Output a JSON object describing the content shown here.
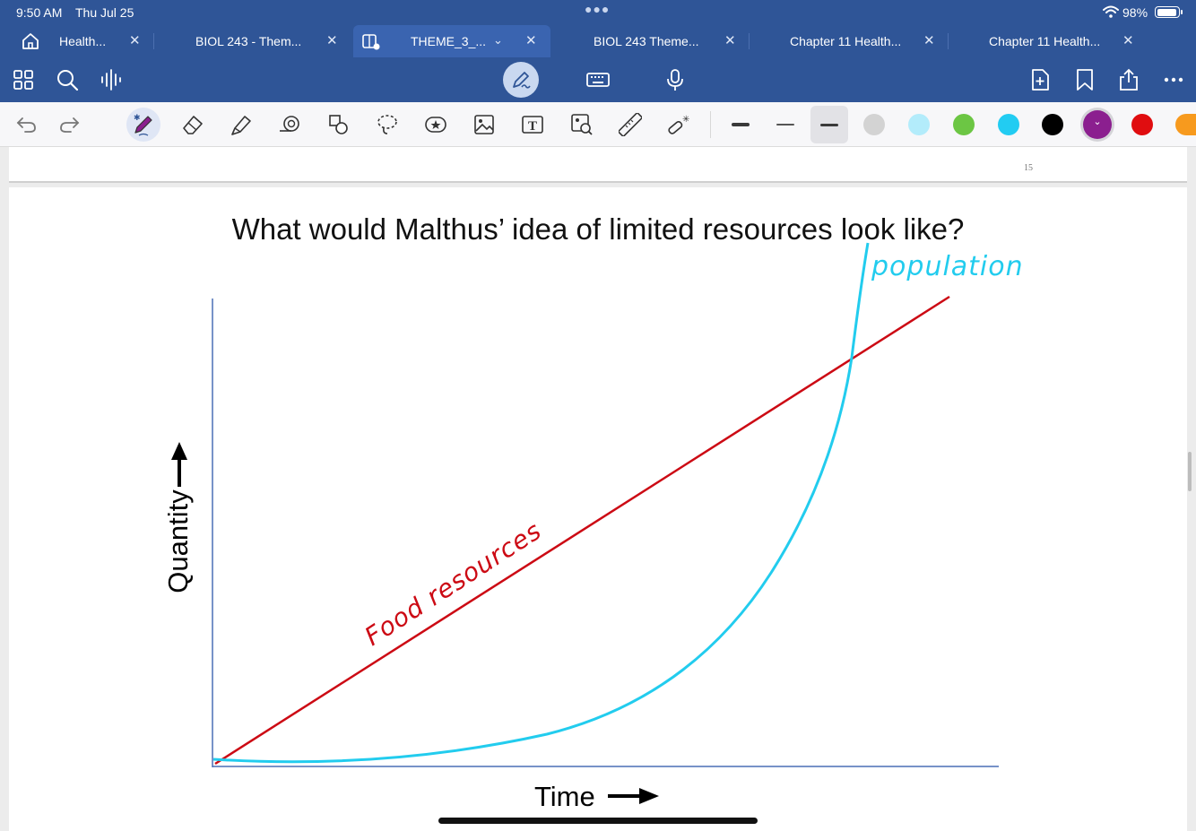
{
  "status_bar": {
    "time": "9:50 AM",
    "date": "Thu Jul 25",
    "battery_percent": "98%",
    "battery_level": 0.98
  },
  "tabs": [
    {
      "label": "Health...",
      "has_close": true,
      "active": false
    },
    {
      "label": "BIOL 243 - Them...",
      "has_close": true,
      "active": false
    },
    {
      "label": "THEME_3_...",
      "has_close": true,
      "active": true
    },
    {
      "label": "BIOL 243 Theme...",
      "has_close": true,
      "active": false
    },
    {
      "label": "Chapter 11 Health...",
      "has_close": true,
      "active": false
    },
    {
      "label": "Chapter 11 Health...",
      "has_close": true,
      "active": false
    }
  ],
  "toolbar": {
    "left_icons": [
      "grid-icon",
      "search-icon",
      "audio-waveform-icon"
    ],
    "center_icons": [
      "pen-mode-icon",
      "keyboard-icon",
      "microphone-icon"
    ],
    "right_icons": [
      "add-page-icon",
      "bookmark-icon",
      "share-icon",
      "more-icon"
    ]
  },
  "drawing_tools": {
    "tools": [
      "undo",
      "redo",
      "pen",
      "eraser",
      "highlighter",
      "tape",
      "shapes",
      "lasso",
      "sticker",
      "image",
      "text",
      "image-search",
      "ruler",
      "laser-pointer"
    ],
    "selected_tool": "pen",
    "stroke_widths": [
      "thick",
      "thin",
      "medium"
    ],
    "selected_stroke": "medium",
    "colors": [
      "#d3d3d3",
      "#b3ecfb",
      "#6cc644",
      "#22ccf2",
      "#000000",
      "#8b1f8f",
      "#e00d10",
      "#f79a1e"
    ],
    "selected_color": "#8b1f8f"
  },
  "page": {
    "page_number": "15",
    "title": "What would Malthus’ idea of limited resources look like?",
    "y_axis_label": "Quantity",
    "x_axis_label": "Time",
    "annotations": {
      "food": "Food resources",
      "population": "population"
    },
    "colors": {
      "food_line": "#cc0a14",
      "population_curve": "#22ccee",
      "axis": "#4a6fb5"
    }
  }
}
